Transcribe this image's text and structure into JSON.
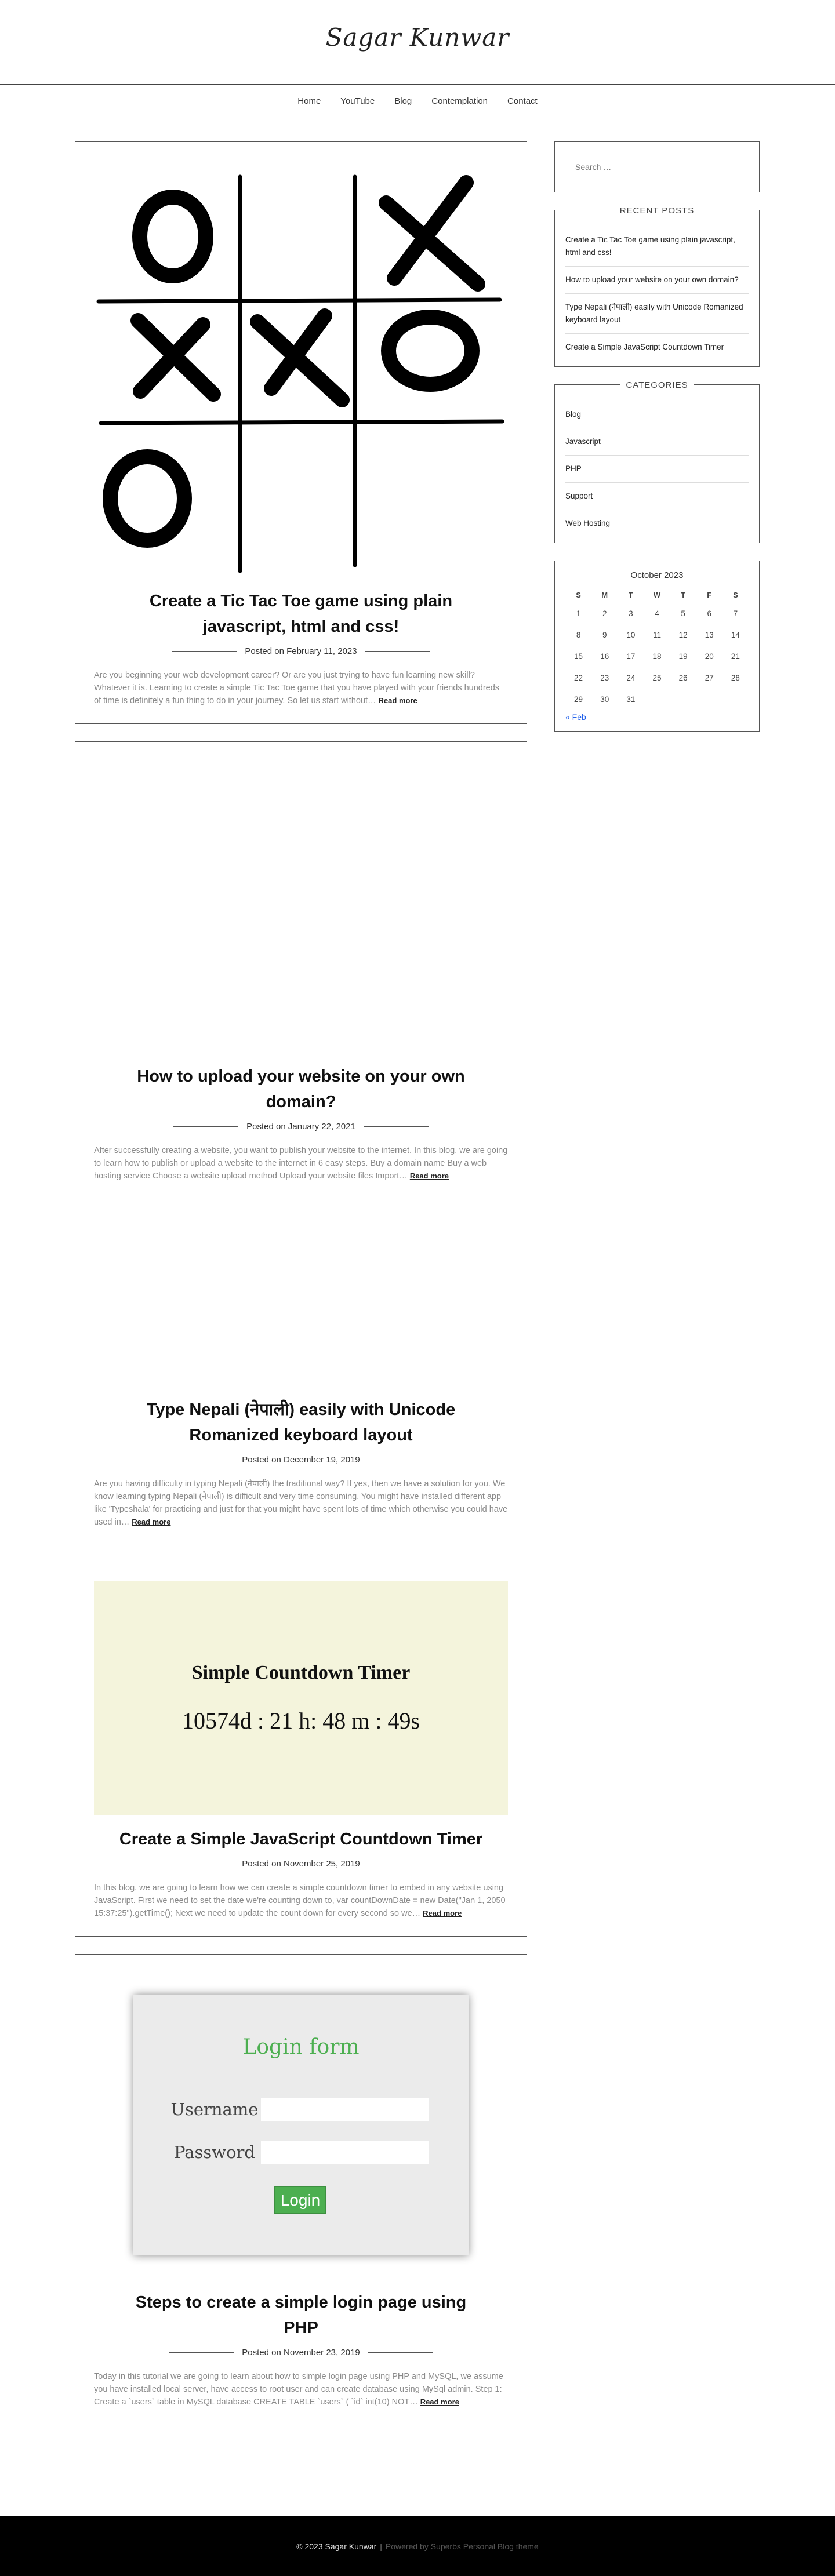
{
  "site": {
    "title": "Sagar Kunwar"
  },
  "nav": [
    "Home",
    "YouTube",
    "Blog",
    "Contemplation",
    "Contact"
  ],
  "posts": [
    {
      "title": "Create a Tic Tac Toe game using plain javascript, html and css!",
      "meta": "Posted on February 11, 2023",
      "excerpt": "Are you beginning your web development career? Or are you just trying to have fun learning new skill? Whatever it is. Learning to create a simple Tic Tac Toe game that you have played with your friends hundreds of time is definitely a fun thing to do in your journey. So let us start without…",
      "read_more": "Read more",
      "image_icon": "tic-tac-toe-board"
    },
    {
      "title": "How to upload your website on your own domain?",
      "meta": "Posted on January 22, 2021",
      "excerpt": "After successfully creating a website, you want to publish your website to the internet. In this blog, we are going to learn how to publish or upload a website to the internet in 6 easy steps. Buy a domain name Buy a web hosting service Choose a website upload method Upload your website files Import…",
      "read_more": "Read more"
    },
    {
      "title": "Type Nepali (नेपाली) easily with Unicode Romanized keyboard layout",
      "meta": "Posted on December 19, 2019",
      "excerpt": "Are you having difficulty in typing Nepali (नेपाली) the traditional way? If yes, then we have a solution for you. We know learning typing Nepali (नेपाली) is difficult and very time consuming. You might have installed different app like 'Typeshala' for practicing and just for that you might have spent lots of time which otherwise you could have used in…",
      "read_more": "Read more"
    },
    {
      "title": "Create a Simple JavaScript Countdown Timer",
      "meta": "Posted on November 25, 2019",
      "excerpt": "In this blog, we are going to learn how we can create a simple countdown timer to embed in any website using JavaScript. First we need to set the date we're counting down to, var countDownDate = new Date(\"Jan 1, 2050 15:37:25\").getTime(); Next we need to update the count down for every second so we…",
      "read_more": "Read more",
      "image_title": "Simple Countdown Timer",
      "image_timer": "10574d : 21 h: 48 m : 49s"
    },
    {
      "title": "Steps to create a simple login page using PHP",
      "meta": "Posted on November 23, 2019",
      "excerpt": "Today in this tutorial we are going to learn about how to simple login page using PHP and MySQL, we assume you have installed local server, have access to root user and can create database using MySql admin.   Step 1: Create a `users` table in MySQL database CREATE TABLE `users` ( `id` int(10) NOT…",
      "read_more": "Read more",
      "image_heading": "Login form",
      "image_username": "Username",
      "image_password": "Password",
      "image_button": "Login"
    }
  ],
  "sidebar": {
    "search_placeholder": "Search …",
    "recent_title": "RECENT POSTS",
    "recent": [
      "Create a Tic Tac Toe game using plain javascript, html and css!",
      "How to upload your website on your own domain?",
      "Type Nepali (नेपाली) easily with Unicode Romanized keyboard layout",
      "Create a Simple JavaScript Countdown Timer"
    ],
    "categories_title": "CATEGORIES",
    "categories": [
      "Blog",
      "Javascript",
      "PHP",
      "Support",
      "Web Hosting"
    ],
    "calendar": {
      "caption": "October 2023",
      "days": [
        "S",
        "M",
        "T",
        "W",
        "T",
        "F",
        "S"
      ],
      "weeks": [
        [
          "1",
          "2",
          "3",
          "4",
          "5",
          "6",
          "7"
        ],
        [
          "8",
          "9",
          "10",
          "11",
          "12",
          "13",
          "14"
        ],
        [
          "15",
          "16",
          "17",
          "18",
          "19",
          "20",
          "21"
        ],
        [
          "22",
          "23",
          "24",
          "25",
          "26",
          "27",
          "28"
        ],
        [
          "29",
          "30",
          "31",
          "",
          "",
          "",
          ""
        ]
      ],
      "prev": "« Feb"
    }
  },
  "footer": {
    "copyright": "© 2023 Sagar Kunwar",
    "separator": "|",
    "powered": "Powered by Superbs Personal Blog theme"
  },
  "colors": {
    "accent_green": "#4caf50",
    "countdown_bg": "#f4f4dc",
    "footer_bg": "#000000",
    "link_blue": "#2563eb"
  }
}
